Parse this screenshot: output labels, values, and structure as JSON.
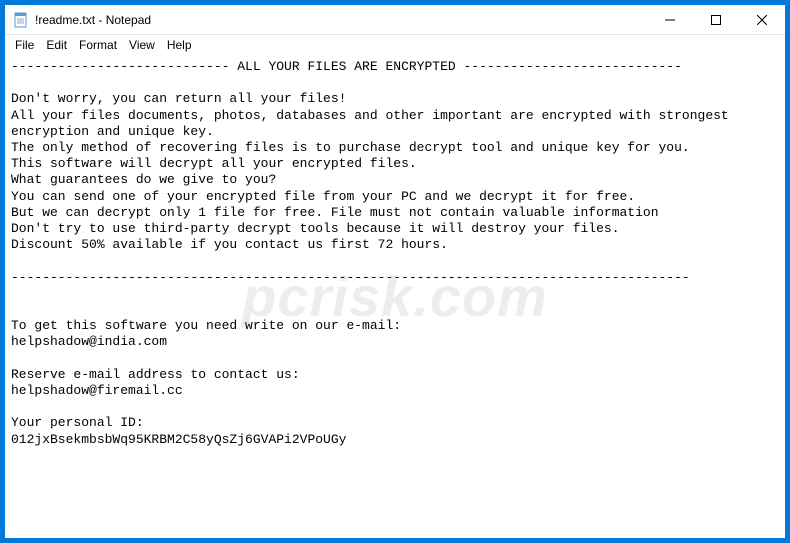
{
  "window": {
    "title": "!readme.txt - Notepad"
  },
  "menu": {
    "file": "File",
    "edit": "Edit",
    "format": "Format",
    "view": "View",
    "help": "Help"
  },
  "content": {
    "text": "---------------------------- ALL YOUR FILES ARE ENCRYPTED ----------------------------\n\nDon't worry, you can return all your files!\nAll your files documents, photos, databases and other important are encrypted with strongest encryption and unique key.\nThe only method of recovering files is to purchase decrypt tool and unique key for you.\nThis software will decrypt all your encrypted files.\nWhat guarantees do we give to you?\nYou can send one of your encrypted file from your PC and we decrypt it for free.\nBut we can decrypt only 1 file for free. File must not contain valuable information\nDon't try to use third-party decrypt tools because it will destroy your files.\nDiscount 50% available if you contact us first 72 hours.\n\n---------------------------------------------------------------------------------------\n\n\nTo get this software you need write on our e-mail:\nhelpshadow@india.com\n\nReserve e-mail address to contact us:\nhelpshadow@firemail.cc\n\nYour personal ID:\n012jxBsekmbsbWq95KRBM2C58yQsZj6GVAPi2VPoUGy"
  },
  "watermark": "pcrisk.com"
}
